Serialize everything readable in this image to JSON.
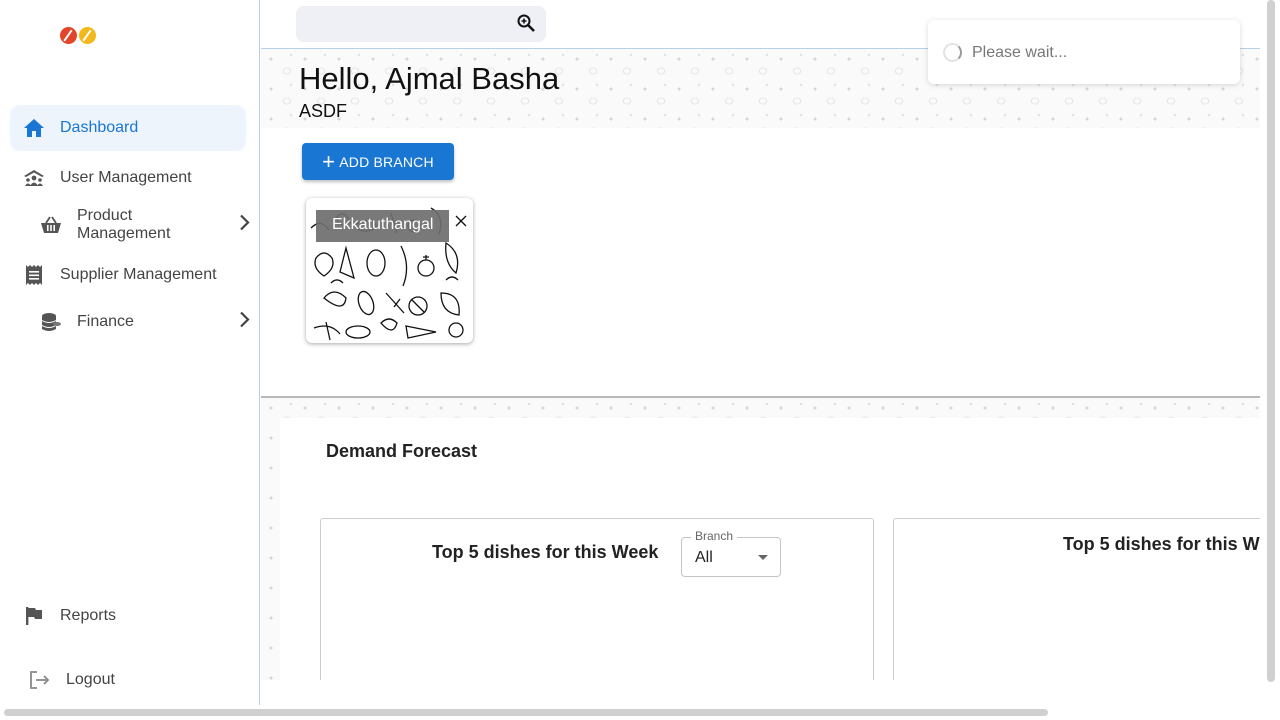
{
  "sidebar": {
    "items": [
      {
        "label": "Dashboard",
        "icon": "home-icon",
        "active": true
      },
      {
        "label": "User Management",
        "icon": "users-icon"
      },
      {
        "label": "Product Management",
        "icon": "basket-icon",
        "has_submenu": true
      },
      {
        "label": "Supplier Management",
        "icon": "receipt-icon"
      },
      {
        "label": "Finance",
        "icon": "coins-icon",
        "has_submenu": true
      }
    ],
    "bottom": [
      {
        "label": "Reports",
        "icon": "flag-icon"
      },
      {
        "label": "Logout",
        "icon": "logout-icon"
      }
    ]
  },
  "search": {
    "placeholder": "",
    "icon": "search-icon"
  },
  "greeting": {
    "title": "Hello, Ajmal Basha",
    "org": "ASDF"
  },
  "actions": {
    "add_branch": "ADD BRANCH"
  },
  "branches": [
    {
      "name": "Ekkatuthangal"
    }
  ],
  "forecast": {
    "title": "Demand Forecast",
    "cards": [
      {
        "title": "Top 5 dishes for this Week",
        "select": {
          "label": "Branch",
          "value": "All"
        }
      },
      {
        "title": "Top 5 dishes for this W"
      }
    ]
  },
  "toast": {
    "message": "Please wait..."
  },
  "colors": {
    "accent": "#1976d2",
    "logo_red": "#e3452b",
    "logo_yellow": "#f4b81b"
  }
}
